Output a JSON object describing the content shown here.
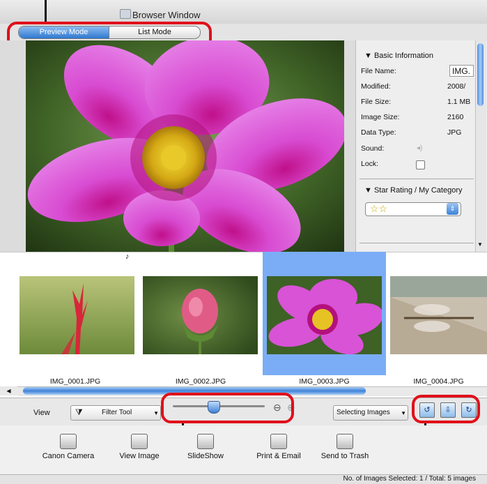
{
  "window": {
    "title": "Browser Window"
  },
  "modes": {
    "preview": "Preview Mode",
    "list": "List Mode",
    "active": "Preview Mode"
  },
  "info": {
    "section_title": "Basic Information",
    "rows": [
      {
        "label": "File Name:",
        "value": "IMG."
      },
      {
        "label": "Modified:",
        "value": "2008/"
      },
      {
        "label": "File Size:",
        "value": "1.1 MB"
      },
      {
        "label": "Image Size:",
        "value": "2160"
      },
      {
        "label": "Data Type:",
        "value": "JPG"
      },
      {
        "label": "Sound:",
        "value": ""
      },
      {
        "label": "Lock:",
        "value": ""
      }
    ],
    "rating_title": "Star Rating / My Category",
    "rating_value": "☆☆",
    "star_rating": 2
  },
  "thumbnails": [
    {
      "caption": "IMG_0001.JPG",
      "selected": false
    },
    {
      "caption": "IMG_0002.JPG",
      "selected": false
    },
    {
      "caption": "IMG_0003.JPG",
      "selected": true
    },
    {
      "caption": "IMG_0004.JPG",
      "selected": false
    }
  ],
  "viewbar": {
    "view_label": "View",
    "filter_label": "Filter Tool",
    "selecting_label": "Selecting Images"
  },
  "toolbar": {
    "canon_camera": "Canon Camera",
    "view_image": "View Image",
    "slideshow": "SlideShow",
    "print_email": "Print & Email",
    "trash": "Send to Trash"
  },
  "status": {
    "text": "No. of Images Selected: 1 / Total: 5 images"
  },
  "colors": {
    "accent": "#3f82d9",
    "highlight": "#e0101a",
    "selection": "#7aadf5"
  }
}
